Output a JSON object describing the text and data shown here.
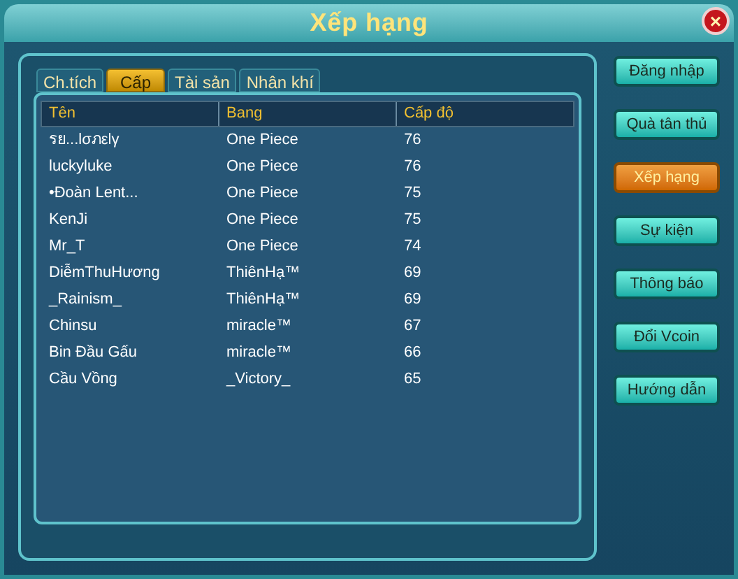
{
  "window": {
    "title": "Xếp hạng",
    "close": "×"
  },
  "tabs": [
    {
      "label": "Ch.tích",
      "selected": false
    },
    {
      "label": "Cấp",
      "selected": true
    },
    {
      "label": "Tài sản",
      "selected": false
    },
    {
      "label": "Nhân khí",
      "selected": false
    }
  ],
  "table": {
    "columns": [
      "Tên",
      "Bang",
      "Cấp độ"
    ],
    "rows": [
      [
        "รย...lσภεlγ",
        "One Piece",
        "76"
      ],
      [
        "luckyluke",
        "One Piece",
        "76"
      ],
      [
        "•Đoàn Lent...",
        "One Piece",
        "75"
      ],
      [
        "KenJi",
        "One Piece",
        "75"
      ],
      [
        "Mr_T",
        "One Piece",
        "74"
      ],
      [
        "DiễmThuHương",
        "ThiênHạ™",
        "69"
      ],
      [
        "_Rainism_",
        "ThiênHạ™",
        "69"
      ],
      [
        "Chinsu",
        "miracle™",
        "67"
      ],
      [
        "Bin Đầu Gấu",
        "miracle™",
        "66"
      ],
      [
        "Cầu Vồng",
        "_Victory_",
        "65"
      ]
    ]
  },
  "side_buttons": [
    {
      "label": "Đăng nhập",
      "selected": false
    },
    {
      "label": "Quà tân thủ",
      "selected": false
    },
    {
      "label": "Xếp hạng",
      "selected": true
    },
    {
      "label": "Sự kiện",
      "selected": false
    },
    {
      "label": "Thông báo",
      "selected": false
    },
    {
      "label": "Đổi Vcoin",
      "selected": false
    },
    {
      "label": "Hướng dẫn",
      "selected": false
    }
  ]
}
